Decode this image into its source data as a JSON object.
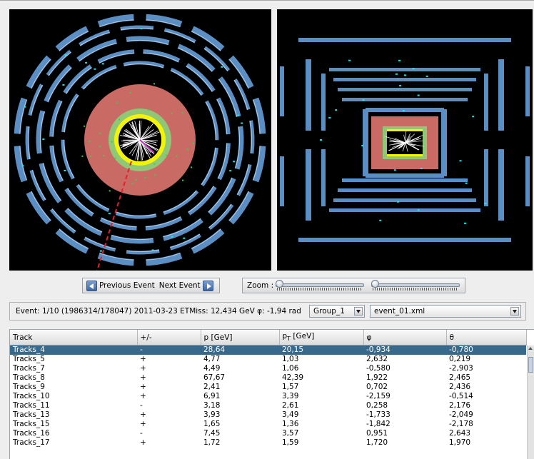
{
  "controls": {
    "previous_label": "Previous Event",
    "next_label": "Next Event",
    "zoom_label": "Zoom :"
  },
  "info": {
    "text": "Event: 1/10 (1986314/178047)  2011-03-23  ETMiss: 12,434 GeV  φ: -1,94 rad",
    "group_value": "Group_1",
    "file_value": "event_01.xml"
  },
  "table": {
    "headers": [
      "Track",
      "+/-",
      "p [GeV]",
      "pT [GeV]",
      "φ",
      "θ"
    ],
    "selected_row": 0,
    "rows": [
      [
        "Tracks_4",
        "-",
        "28,64",
        "20,15",
        "-0,934",
        "-0,780"
      ],
      [
        "Tracks_5",
        "+",
        "4,77",
        "1,03",
        "2,632",
        "0,219"
      ],
      [
        "Tracks_7",
        "+",
        "4,49",
        "1,06",
        "-0,580",
        "-2,903"
      ],
      [
        "Tracks_8",
        "+",
        "67,67",
        "42,39",
        "1,922",
        "2,465"
      ],
      [
        "Tracks_9",
        "+",
        "2,41",
        "1,57",
        "0,702",
        "2,436"
      ],
      [
        "Tracks_10",
        "+",
        "6,91",
        "3,39",
        "-2,159",
        "-0,514"
      ],
      [
        "Tracks_11",
        "-",
        "3,18",
        "2,61",
        "0,258",
        "2,176"
      ],
      [
        "Tracks_13",
        "+",
        "3,93",
        "3,49",
        "-1,733",
        "-2,049"
      ],
      [
        "Tracks_15",
        "+",
        "1,65",
        "1,36",
        "-1,842",
        "-2,178"
      ],
      [
        "Tracks_16",
        "-",
        "7,45",
        "3,57",
        "0,951",
        "2,643"
      ],
      [
        "Tracks_17",
        "+",
        "1,72",
        "1,59",
        "1,720",
        "1,970"
      ]
    ]
  },
  "colors": {
    "detector_blue": "#5b8fc4",
    "calorimeter_red": "#c96a64",
    "inner_green": "#8fc777",
    "hits_yellow": "#f2f20a",
    "missing_et_red": "#e3202a",
    "selection": "#39698a"
  }
}
